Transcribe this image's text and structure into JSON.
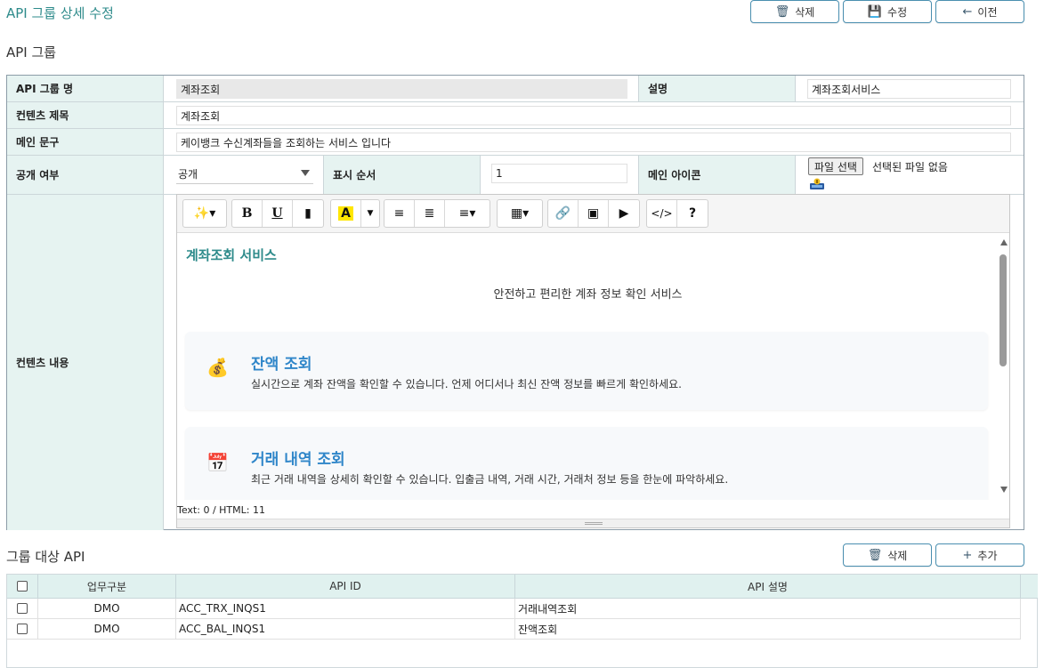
{
  "page": {
    "title": "API 그룹 상세 수정",
    "buttons": {
      "delete": "삭제",
      "save": "수정",
      "back": "이전"
    }
  },
  "group_section": {
    "heading": "API 그룹",
    "fields": {
      "group_name_label": "API 그룹 명",
      "group_name_value": "계좌조회",
      "description_label": "설명",
      "description_value": "계좌조회서비스",
      "content_title_label": "컨텐츠 제목",
      "content_title_value": "계좌조회",
      "main_text_label": "메인 문구",
      "main_text_value": "케이뱅크 수신계좌들을 조회하는 서비스 입니다",
      "public_label": "공개 여부",
      "public_value": "공개",
      "order_label": "표시 순서",
      "order_value": "1",
      "icon_label": "메인 아이콘",
      "file_button": "파일 선택",
      "file_status": "선택된 파일 없음",
      "content_label": "컨텐츠 내용"
    }
  },
  "editor": {
    "heading": "계좌조회 서비스",
    "subtitle": "안전하고 편리한 계좌 정보 확인 서비스",
    "cards": [
      {
        "icon": "money-bag-icon",
        "icon_glyph": "💰",
        "title": "잔액 조회",
        "desc": "실시간으로 계좌 잔액을 확인할 수 있습니다. 언제 어디서나 최신 잔액 정보를 빠르게 확인하세요."
      },
      {
        "icon": "calendar-icon",
        "icon_glyph": "📅",
        "title": "거래 내역 조회",
        "desc": "최근 거래 내역을 상세히 확인할 수 있습니다. 입출금 내역, 거래 시간, 거래처 정보 등을 한눈에 파악하세요."
      }
    ],
    "status": "Text: 0 / HTML: 11"
  },
  "api_section": {
    "heading": "그룹 대상 API",
    "buttons": {
      "delete": "삭제",
      "add": "추가"
    },
    "columns": [
      "업무구분",
      "API ID",
      "API 설명"
    ],
    "rows": [
      {
        "biz": "DMO",
        "api_id": "ACC_TRX_INQS1",
        "desc": "거래내역조회"
      },
      {
        "biz": "DMO",
        "api_id": "ACC_BAL_INQS1",
        "desc": "잔액조회"
      }
    ]
  },
  "colors": {
    "accent": "#2e8b8b",
    "label_bg": "#e6f3f1",
    "card_title": "#2f86c9"
  }
}
